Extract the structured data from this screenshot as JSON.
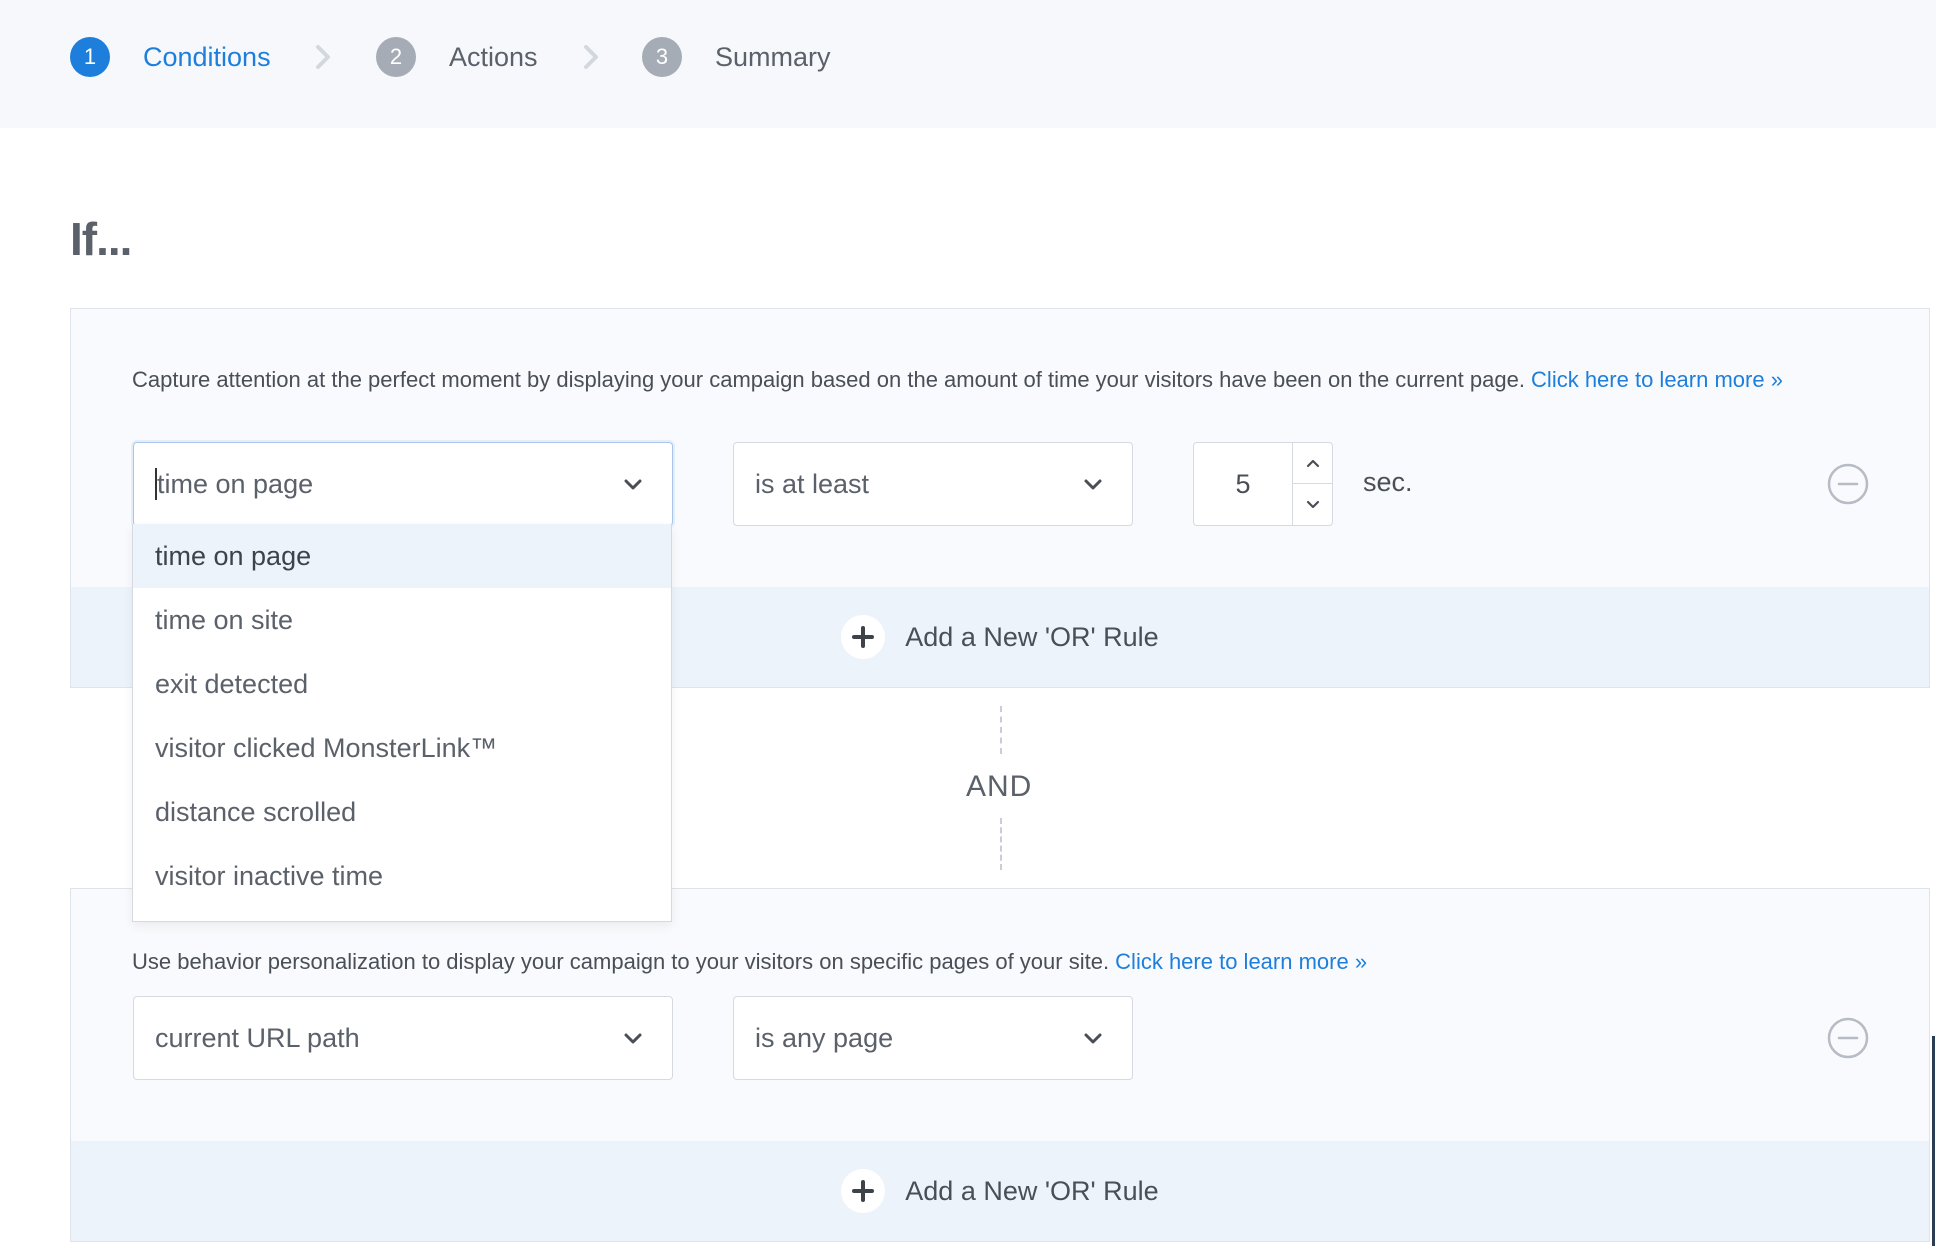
{
  "stepper": {
    "steps": [
      {
        "number": "1",
        "label": "Conditions",
        "state": "active"
      },
      {
        "number": "2",
        "label": "Actions",
        "state": "inactive"
      },
      {
        "number": "3",
        "label": "Summary",
        "state": "inactive"
      }
    ]
  },
  "heading": "If...",
  "rule1": {
    "description": "Capture attention at the perfect moment by displaying your campaign based on the amount of time your visitors have been on the current page. ",
    "learn_more": "Click here to learn more »",
    "condition_select": "time on page",
    "operator_select": "is at least",
    "number_value": "5",
    "unit": "sec.",
    "add_or_rule": "Add a New 'OR' Rule"
  },
  "connector": "AND",
  "rule2": {
    "description": "Use behavior personalization to display your campaign to your visitors on specific pages of your site. ",
    "learn_more": "Click here to learn more »",
    "condition_select": "current URL path",
    "operator_select": "is any page",
    "add_or_rule": "Add a New 'OR' Rule"
  },
  "dropdown": {
    "options": [
      "time on page",
      "time on site",
      "exit detected",
      "visitor clicked MonsterLink™",
      "distance scrolled",
      "visitor inactive time"
    ],
    "selected_index": 0
  },
  "colors": {
    "accent": "#1d7fdb",
    "step_inactive": "#a6acb5",
    "panel_bg": "#f8fafd",
    "or_bar_bg": "#edf3fb"
  },
  "icons": [
    "chevron-right-icon",
    "chevron-down-icon",
    "chevron-up-icon",
    "minus-circle-icon",
    "plus-icon"
  ]
}
